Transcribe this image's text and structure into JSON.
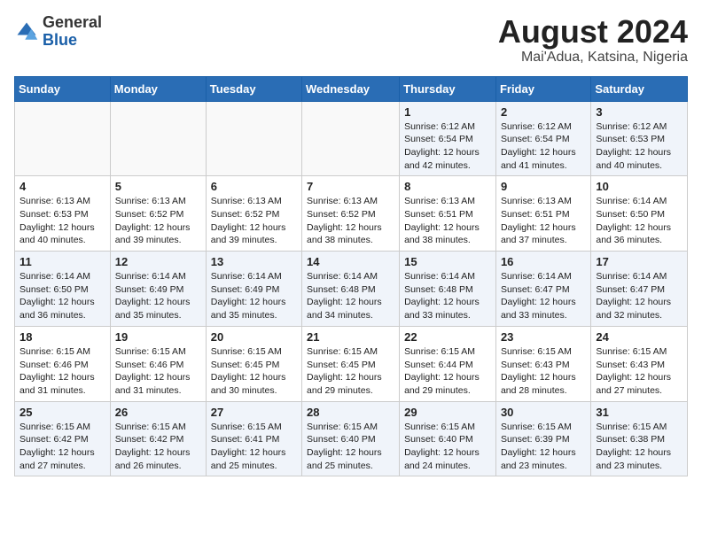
{
  "header": {
    "logo_general": "General",
    "logo_blue": "Blue",
    "month_year": "August 2024",
    "location": "Mai'Adua, Katsina, Nigeria"
  },
  "weekdays": [
    "Sunday",
    "Monday",
    "Tuesday",
    "Wednesday",
    "Thursday",
    "Friday",
    "Saturday"
  ],
  "weeks": [
    [
      {
        "day": "",
        "detail": ""
      },
      {
        "day": "",
        "detail": ""
      },
      {
        "day": "",
        "detail": ""
      },
      {
        "day": "",
        "detail": ""
      },
      {
        "day": "1",
        "detail": "Sunrise: 6:12 AM\nSunset: 6:54 PM\nDaylight: 12 hours and 42 minutes."
      },
      {
        "day": "2",
        "detail": "Sunrise: 6:12 AM\nSunset: 6:54 PM\nDaylight: 12 hours and 41 minutes."
      },
      {
        "day": "3",
        "detail": "Sunrise: 6:12 AM\nSunset: 6:53 PM\nDaylight: 12 hours and 40 minutes."
      }
    ],
    [
      {
        "day": "4",
        "detail": "Sunrise: 6:13 AM\nSunset: 6:53 PM\nDaylight: 12 hours and 40 minutes."
      },
      {
        "day": "5",
        "detail": "Sunrise: 6:13 AM\nSunset: 6:52 PM\nDaylight: 12 hours and 39 minutes."
      },
      {
        "day": "6",
        "detail": "Sunrise: 6:13 AM\nSunset: 6:52 PM\nDaylight: 12 hours and 39 minutes."
      },
      {
        "day": "7",
        "detail": "Sunrise: 6:13 AM\nSunset: 6:52 PM\nDaylight: 12 hours and 38 minutes."
      },
      {
        "day": "8",
        "detail": "Sunrise: 6:13 AM\nSunset: 6:51 PM\nDaylight: 12 hours and 38 minutes."
      },
      {
        "day": "9",
        "detail": "Sunrise: 6:13 AM\nSunset: 6:51 PM\nDaylight: 12 hours and 37 minutes."
      },
      {
        "day": "10",
        "detail": "Sunrise: 6:14 AM\nSunset: 6:50 PM\nDaylight: 12 hours and 36 minutes."
      }
    ],
    [
      {
        "day": "11",
        "detail": "Sunrise: 6:14 AM\nSunset: 6:50 PM\nDaylight: 12 hours and 36 minutes."
      },
      {
        "day": "12",
        "detail": "Sunrise: 6:14 AM\nSunset: 6:49 PM\nDaylight: 12 hours and 35 minutes."
      },
      {
        "day": "13",
        "detail": "Sunrise: 6:14 AM\nSunset: 6:49 PM\nDaylight: 12 hours and 35 minutes."
      },
      {
        "day": "14",
        "detail": "Sunrise: 6:14 AM\nSunset: 6:48 PM\nDaylight: 12 hours and 34 minutes."
      },
      {
        "day": "15",
        "detail": "Sunrise: 6:14 AM\nSunset: 6:48 PM\nDaylight: 12 hours and 33 minutes."
      },
      {
        "day": "16",
        "detail": "Sunrise: 6:14 AM\nSunset: 6:47 PM\nDaylight: 12 hours and 33 minutes."
      },
      {
        "day": "17",
        "detail": "Sunrise: 6:14 AM\nSunset: 6:47 PM\nDaylight: 12 hours and 32 minutes."
      }
    ],
    [
      {
        "day": "18",
        "detail": "Sunrise: 6:15 AM\nSunset: 6:46 PM\nDaylight: 12 hours and 31 minutes."
      },
      {
        "day": "19",
        "detail": "Sunrise: 6:15 AM\nSunset: 6:46 PM\nDaylight: 12 hours and 31 minutes."
      },
      {
        "day": "20",
        "detail": "Sunrise: 6:15 AM\nSunset: 6:45 PM\nDaylight: 12 hours and 30 minutes."
      },
      {
        "day": "21",
        "detail": "Sunrise: 6:15 AM\nSunset: 6:45 PM\nDaylight: 12 hours and 29 minutes."
      },
      {
        "day": "22",
        "detail": "Sunrise: 6:15 AM\nSunset: 6:44 PM\nDaylight: 12 hours and 29 minutes."
      },
      {
        "day": "23",
        "detail": "Sunrise: 6:15 AM\nSunset: 6:43 PM\nDaylight: 12 hours and 28 minutes."
      },
      {
        "day": "24",
        "detail": "Sunrise: 6:15 AM\nSunset: 6:43 PM\nDaylight: 12 hours and 27 minutes."
      }
    ],
    [
      {
        "day": "25",
        "detail": "Sunrise: 6:15 AM\nSunset: 6:42 PM\nDaylight: 12 hours and 27 minutes."
      },
      {
        "day": "26",
        "detail": "Sunrise: 6:15 AM\nSunset: 6:42 PM\nDaylight: 12 hours and 26 minutes."
      },
      {
        "day": "27",
        "detail": "Sunrise: 6:15 AM\nSunset: 6:41 PM\nDaylight: 12 hours and 25 minutes."
      },
      {
        "day": "28",
        "detail": "Sunrise: 6:15 AM\nSunset: 6:40 PM\nDaylight: 12 hours and 25 minutes."
      },
      {
        "day": "29",
        "detail": "Sunrise: 6:15 AM\nSunset: 6:40 PM\nDaylight: 12 hours and 24 minutes."
      },
      {
        "day": "30",
        "detail": "Sunrise: 6:15 AM\nSunset: 6:39 PM\nDaylight: 12 hours and 23 minutes."
      },
      {
        "day": "31",
        "detail": "Sunrise: 6:15 AM\nSunset: 6:38 PM\nDaylight: 12 hours and 23 minutes."
      }
    ]
  ]
}
